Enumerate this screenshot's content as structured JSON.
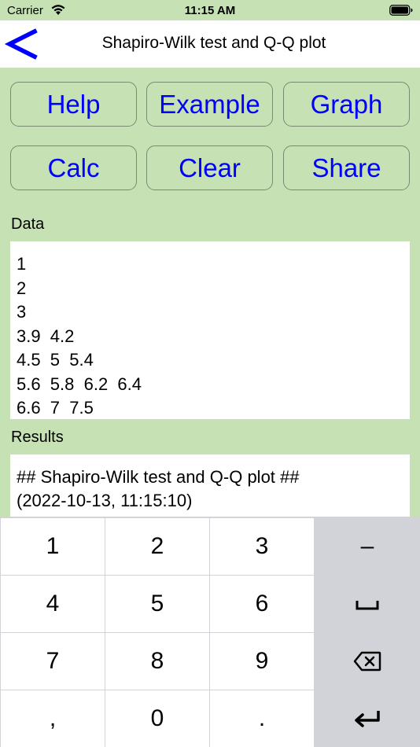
{
  "status_bar": {
    "carrier": "Carrier",
    "time": "11:15 AM"
  },
  "nav": {
    "back_icon": "chevron-left-icon",
    "title": "Shapiro-Wilk test and Q-Q plot"
  },
  "buttons": {
    "help": "Help",
    "example": "Example",
    "graph": "Graph",
    "calc": "Calc",
    "clear": "Clear",
    "share": "Share"
  },
  "data_section": {
    "label": "Data",
    "lines": [
      "1",
      "2",
      "3",
      "3.9  4.2",
      "4.5  5  5.4",
      "5.6  5.8  6.2  6.4",
      "6.6  7  7.5"
    ]
  },
  "results_section": {
    "label": "Results",
    "lines": [
      "## Shapiro-Wilk test and Q-Q plot ##",
      "(2022-10-13, 11:15:10)"
    ]
  },
  "keyboard": {
    "keys": [
      "1",
      "2",
      "3",
      "-",
      "4",
      "5",
      "6",
      "space",
      "7",
      "8",
      "9",
      "delete",
      ",",
      "0",
      ".",
      "return"
    ],
    "key_1": "1",
    "key_2": "2",
    "key_3": "3",
    "key_minus": "–",
    "key_4": "4",
    "key_5": "5",
    "key_6": "6",
    "key_7": "7",
    "key_8": "8",
    "key_9": "9",
    "key_comma": ",",
    "key_0": "0",
    "key_period": "."
  },
  "colors": {
    "background": "#c6e2b5",
    "button_text": "#0000ff",
    "keyboard_bg": "#d1d3d8"
  }
}
